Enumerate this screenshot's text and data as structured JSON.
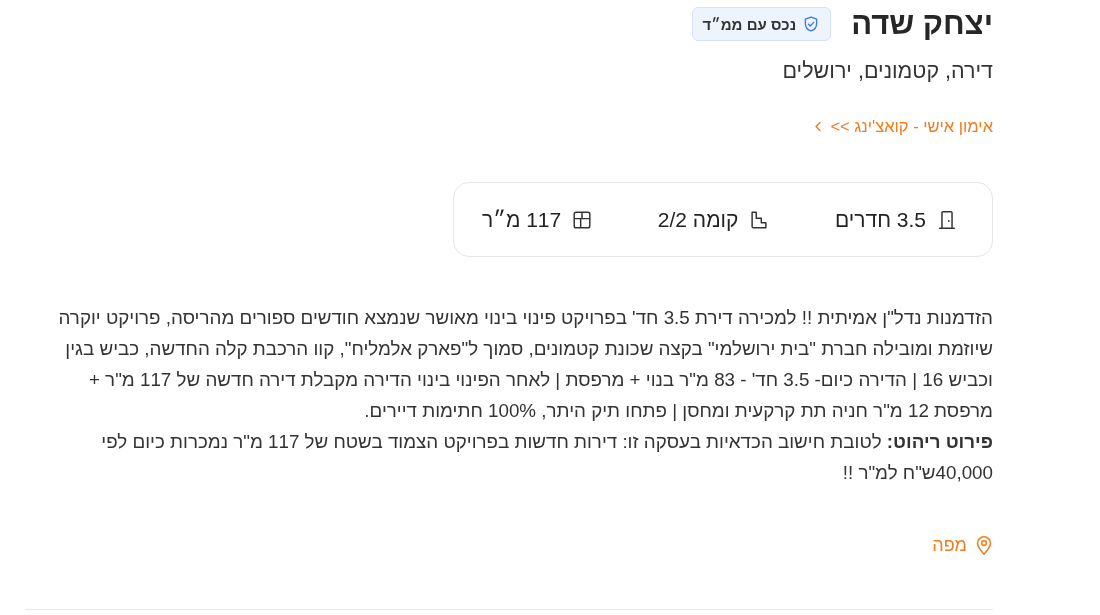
{
  "listing": {
    "title": "יצחק שדה",
    "badge": "נכס עם ממ״ד",
    "subtitle": "דירה, קטמונים, ירושלים",
    "promo_link": "אימון אישי - קואצ'ינג >>"
  },
  "features": [
    {
      "kind": "rooms",
      "label": "3.5 חדרים"
    },
    {
      "kind": "floor",
      "label": "קומה 2/2"
    },
    {
      "kind": "area",
      "label": "117 מ״ר"
    }
  ],
  "description": [
    "הזדמנות נדל\"ן אמיתית !! למכירה דירת 3.5 חד' בפרויקט פינוי בינוי מאושר שנמצא חודשים ספורים מהריסה, פרויקט יוקרה שיוזמת ומובילה חברת \"בית ירושלמי\" בקצה שכונת קטמונים, סמוך ל\"פארק אלמליח\", קוו הרכבת קלה החדשה, כביש בגין וכביש 16 | הדירה כיום- 3.5 חד' - 83 מ\"ר בנוי + מרפסת | לאחר הפינוי בינוי הדירה מקבלת דירה חדשה של 117 מ\"ר + מרפסת 12 מ\"ר חניה תת קרקעית ומחסן | פתחו תיק היתר, 100% חתימות דיירים.",
    "**פירוט ריהוט:** לטובת חישוב הכדאיות בעסקה זו: דירות חדשות בפרויקט הצמוד בשטח של 117 מ\"ר נמכרות כיום לפי 40,000ש\"ח למ\"ר !!"
  ],
  "map_link": "מפה"
}
